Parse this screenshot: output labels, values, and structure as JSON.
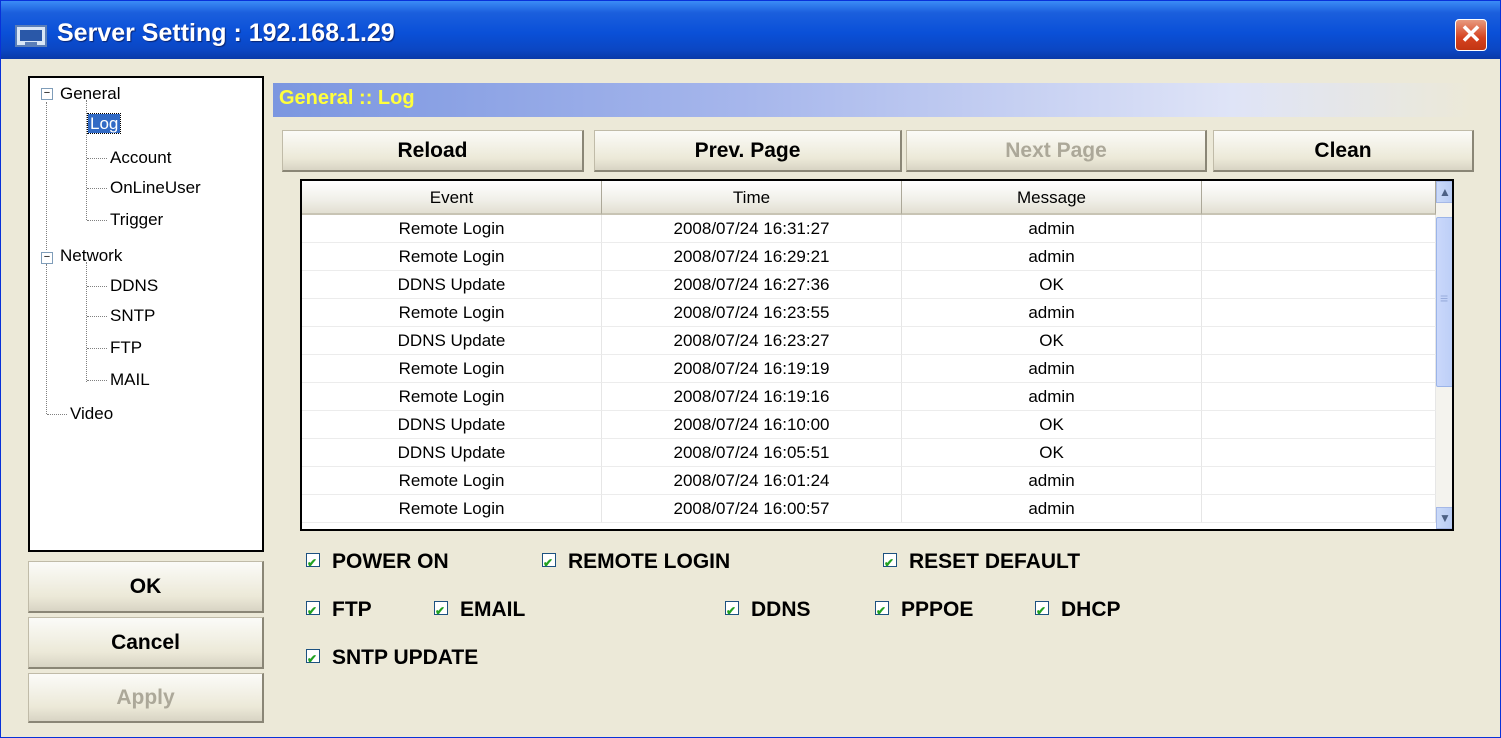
{
  "window": {
    "title": "Server Setting : 192.168.1.29",
    "close_glyph": "✕"
  },
  "tree": {
    "general": "General",
    "general_children": [
      "Log",
      "Account",
      "OnLineUser",
      "Trigger"
    ],
    "network": "Network",
    "network_children": [
      "DDNS",
      "SNTP",
      "FTP",
      "MAIL"
    ],
    "video": "Video",
    "expander_glyph": "−"
  },
  "dialog_buttons": {
    "ok": "OK",
    "cancel": "Cancel",
    "apply": "Apply"
  },
  "section_title": "General :: Log",
  "toolbar": {
    "reload": "Reload",
    "prev": "Prev. Page",
    "next": "Next Page",
    "clean": "Clean"
  },
  "log_table": {
    "columns": [
      "Event",
      "Time",
      "Message"
    ],
    "rows": [
      [
        "Remote Login",
        "2008/07/24 16:31:27",
        "admin"
      ],
      [
        "Remote Login",
        "2008/07/24 16:29:21",
        "admin"
      ],
      [
        "DDNS Update",
        "2008/07/24 16:27:36",
        "OK"
      ],
      [
        "Remote Login",
        "2008/07/24 16:23:55",
        "admin"
      ],
      [
        "DDNS Update",
        "2008/07/24 16:23:27",
        "OK"
      ],
      [
        "Remote Login",
        "2008/07/24 16:19:19",
        "admin"
      ],
      [
        "Remote Login",
        "2008/07/24 16:19:16",
        "admin"
      ],
      [
        "DDNS Update",
        "2008/07/24 16:10:00",
        "OK"
      ],
      [
        "DDNS Update",
        "2008/07/24 16:05:51",
        "OK"
      ],
      [
        "Remote Login",
        "2008/07/24 16:01:24",
        "admin"
      ],
      [
        "Remote Login",
        "2008/07/24 16:00:57",
        "admin"
      ]
    ]
  },
  "filters": {
    "power_on": "POWER ON",
    "remote_login": "REMOTE LOGIN",
    "reset_default": "RESET DEFAULT",
    "ftp": "FTP",
    "email": "EMAIL",
    "ddns": "DDNS",
    "pppoe": "PPPOE",
    "dhcp": "DHCP",
    "sntp_update": "SNTP UPDATE"
  }
}
